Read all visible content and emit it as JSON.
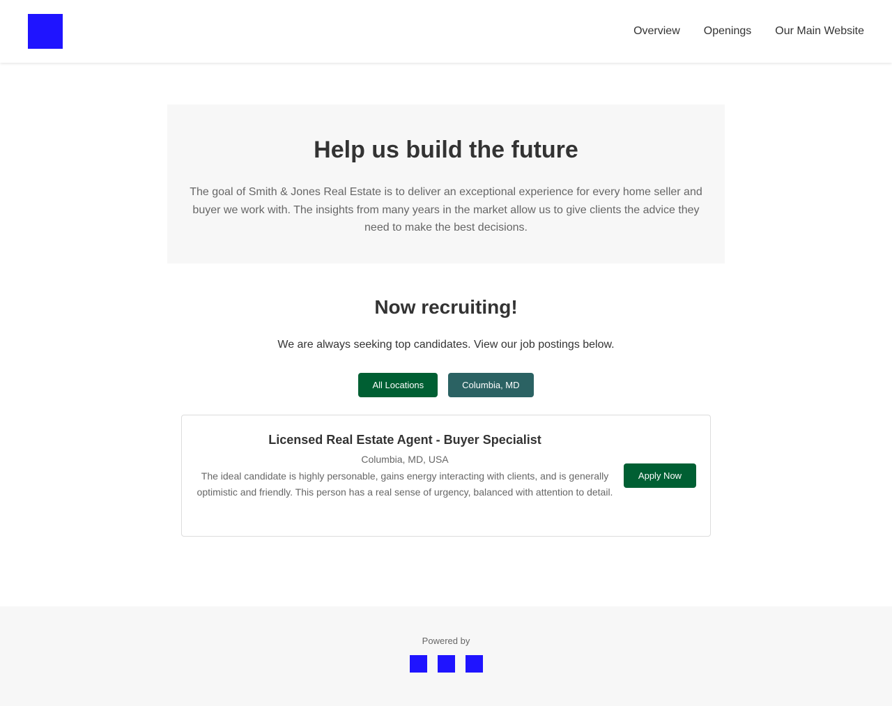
{
  "header": {
    "nav": [
      {
        "label": "Overview"
      },
      {
        "label": "Openings"
      },
      {
        "label": "Our Main Website"
      }
    ]
  },
  "hero": {
    "title": "Help us build the future",
    "text": "The goal of Smith & Jones Real Estate is to deliver an exceptional experience for every home seller and buyer we work with. The insights from many years in the market allow us to give clients the advice they need to make the best decisions."
  },
  "recruiting": {
    "title": "Now recruiting!",
    "subtitle": "We are always seeking top candidates. View our job postings below."
  },
  "filters": [
    {
      "label": "All Locations",
      "active": true
    },
    {
      "label": "Columbia, MD",
      "active": false
    }
  ],
  "jobs": [
    {
      "title": "Licensed Real Estate Agent - Buyer Specialist",
      "location": "Columbia, MD, USA",
      "description": "The ideal candidate is highly personable, gains energy interacting with clients, and is generally optimistic and friendly. This person has a real sense of urgency, balanced with attention to detail.",
      "apply_label": "Apply Now"
    }
  ],
  "footer": {
    "powered_by": "Powered by"
  },
  "colors": {
    "primary_button": "#005f33",
    "secondary_button": "#2b6263",
    "placeholder_image": "#1f14ff",
    "panel_background": "#f7f7f7"
  },
  "icons": {
    "logo": "company-logo-placeholder",
    "footer": [
      "brand-icon-placeholder",
      "brand-icon-placeholder",
      "brand-icon-placeholder"
    ]
  }
}
